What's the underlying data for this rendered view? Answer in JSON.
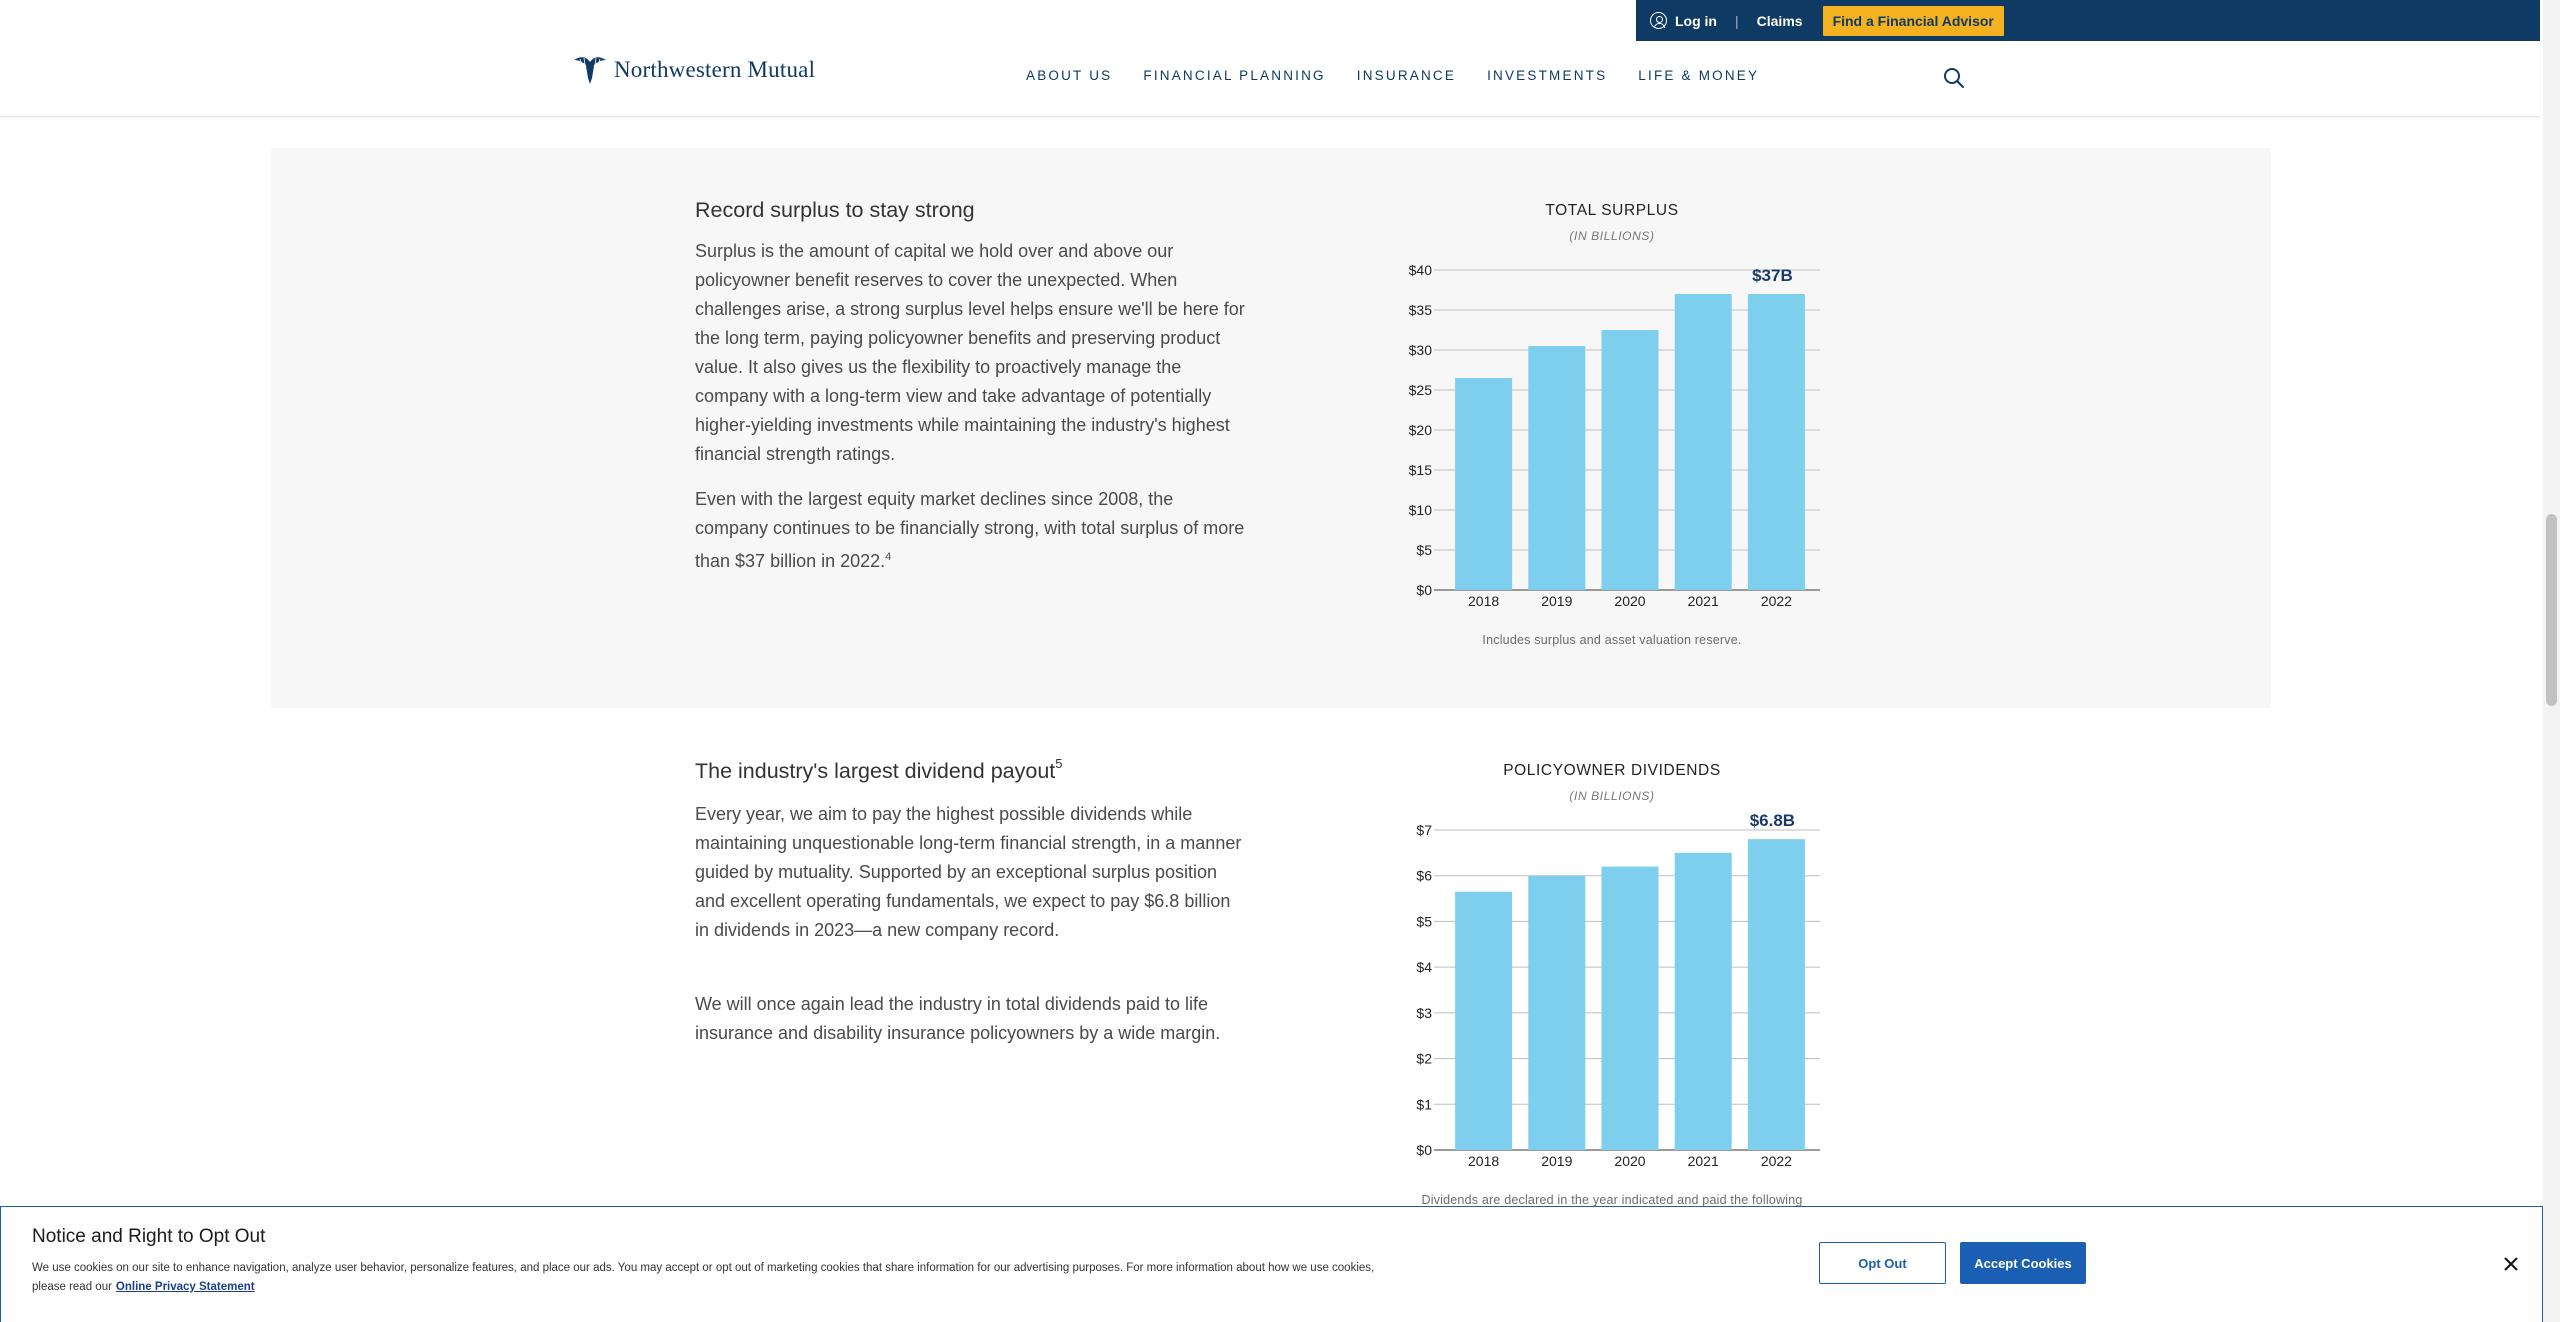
{
  "utility": {
    "login": "Log in",
    "claims": "Claims",
    "separator": "|",
    "advisor": "Find a Financial Advisor"
  },
  "header": {
    "logo_text": "Northwestern Mutual",
    "nav": [
      "ABOUT US",
      "FINANCIAL PLANNING",
      "INSURANCE",
      "INVESTMENTS",
      "LIFE & MONEY"
    ]
  },
  "section_surplus": {
    "heading": "Record surplus to stay strong",
    "para1": "Surplus is the amount of capital we hold over and above our policyowner benefit reserves to cover the unexpected. When challenges arise, a strong surplus level helps ensure we'll be here for the long term, paying policyowner benefits and preserving product value. It also gives us the flexibility to proactively manage the company with a long-term view and take advantage of potentially higher-yielding investments while maintaining the industry's highest financial strength ratings.",
    "para2": "Even with the largest equity market declines since 2008, the company continues to be financially strong, with total surplus of more than $37 billion in 2022.",
    "para2_footnote": "4",
    "chart_subtitle": "(IN BILLIONS)",
    "chart_note": "Includes surplus and asset valuation reserve."
  },
  "section_dividends": {
    "heading": "The industry's largest dividend payout",
    "heading_footnote": "5",
    "para1": "Every year, we aim to pay the highest possible dividends while maintaining unquestionable long-term financial strength, in a manner guided by mutuality. Supported by an exceptional surplus position and excellent operating fundamentals, we expect to pay $6.8 billion in dividends in 2023—a new company record.",
    "para2": "We will once again lead the industry in total dividends paid to life insurance and disability insurance policyowners by a wide margin.",
    "chart_subtitle": "(IN BILLIONS)",
    "chart_note": "Dividends are declared in the year indicated and paid the following"
  },
  "chart_data": [
    {
      "type": "bar",
      "title": "TOTAL SURPLUS",
      "categories": [
        "2018",
        "2019",
        "2020",
        "2021",
        "2022"
      ],
      "values": [
        26.5,
        30.5,
        32.5,
        37,
        37
      ],
      "ylim": [
        0,
        40
      ],
      "yticks": [
        "$0",
        "$5",
        "$10",
        "$15",
        "$20",
        "$25",
        "$30",
        "$35",
        "$40"
      ],
      "annotation": "$37B",
      "grid": true,
      "bar_color": "#7ecfee",
      "annotation_color": "#1a3a6b"
    },
    {
      "type": "bar",
      "title": "POLICYOWNER DIVIDENDS",
      "categories": [
        "2018",
        "2019",
        "2020",
        "2021",
        "2022"
      ],
      "values": [
        5.65,
        6.0,
        6.2,
        6.5,
        6.8
      ],
      "ylim": [
        0,
        7
      ],
      "yticks": [
        "$0",
        "$1",
        "$2",
        "$3",
        "$4",
        "$5",
        "$6",
        "$7"
      ],
      "annotation": "$6.8B",
      "grid": true,
      "bar_color": "#7ecfee",
      "annotation_color": "#1a3a6b"
    }
  ],
  "cookie": {
    "title": "Notice and Right to Opt Out",
    "body": "We use cookies on our site to enhance navigation, analyze user behavior, personalize features, and place our ads. You may accept or opt out of marketing cookies that share information for our advertising purposes. For more information about how we use cookies, please read our",
    "link": "Online Privacy Statement",
    "opt_out": "Opt Out",
    "accept": "Accept Cookies",
    "close_icon": "close-icon"
  },
  "colors": {
    "brand_navy": "#0f3a63",
    "advisor_yellow": "#f4b120",
    "section_bg": "#f7f7f8",
    "cookie_blue": "#1a5fb4"
  }
}
